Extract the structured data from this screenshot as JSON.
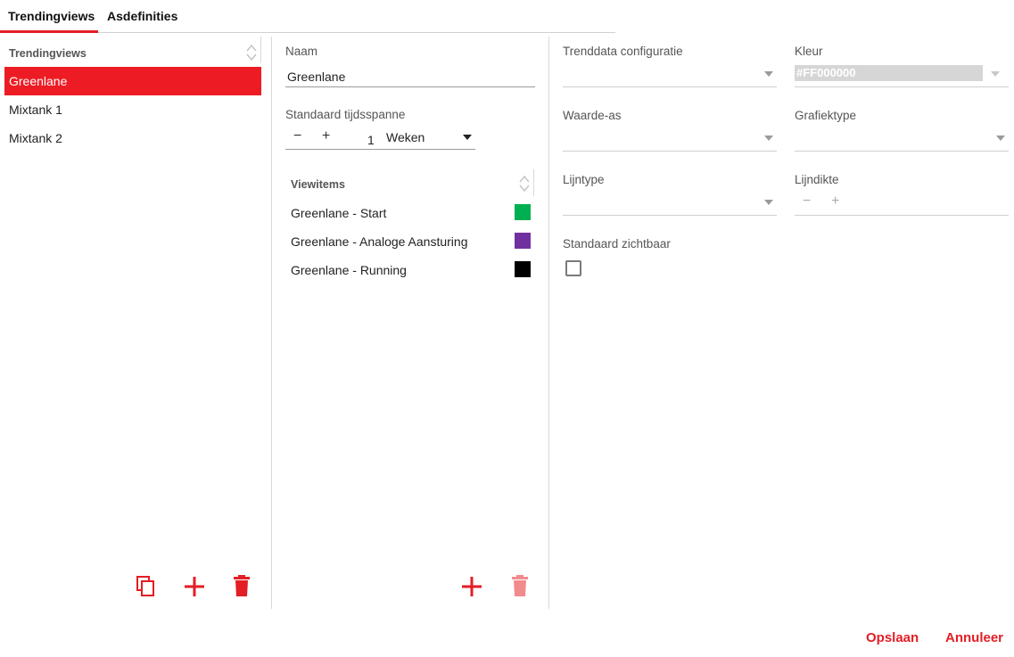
{
  "tabs": [
    {
      "label": "Trendingviews"
    },
    {
      "label": "Asdefinities"
    }
  ],
  "left_panel": {
    "header": "Trendingviews",
    "items": [
      {
        "label": "Greenlane"
      },
      {
        "label": "Mixtank 1"
      },
      {
        "label": "Mixtank 2"
      }
    ],
    "selected_index": 0,
    "actions": [
      "copy-icon",
      "add-icon",
      "delete-icon"
    ]
  },
  "middle_panel": {
    "name_label": "Naam",
    "name_value": "Greenlane",
    "timespan_label": "Standaard tijdsspanne",
    "timespan_minus": "−",
    "timespan_plus": "+",
    "timespan_value": "1",
    "timespan_unit": "Weken",
    "viewitems_header": "Viewitems",
    "viewitems": [
      {
        "label": "Greenlane - Start",
        "color": "#00b050"
      },
      {
        "label": "Greenlane - Analoge Aansturing",
        "color": "#7030a0"
      },
      {
        "label": "Greenlane - Running",
        "color": "#000000"
      }
    ],
    "actions": [
      "add-icon",
      "delete-icon"
    ]
  },
  "right_panel": {
    "trenddata_label": "Trenddata configuratie",
    "trenddata_value": "",
    "kleur_label": "Kleur",
    "kleur_value": "#FF000000",
    "waarde_as_label": "Waarde-as",
    "grafiektype_label": "Grafiektype",
    "lijntype_label": "Lijntype",
    "lijndikte_label": "Lijndikte",
    "lijndikte_minus": "−",
    "lijndikte_plus": "+",
    "zichtbaar_label": "Standaard zichtbaar",
    "zichtbaar_checked": false
  },
  "footer": {
    "save_label": "Opslaan",
    "cancel_label": "Annuleer"
  },
  "colors": {
    "accent": "#e31e24",
    "selected_bg": "#ed1c24",
    "disabled_accent": "#f28b8e"
  }
}
